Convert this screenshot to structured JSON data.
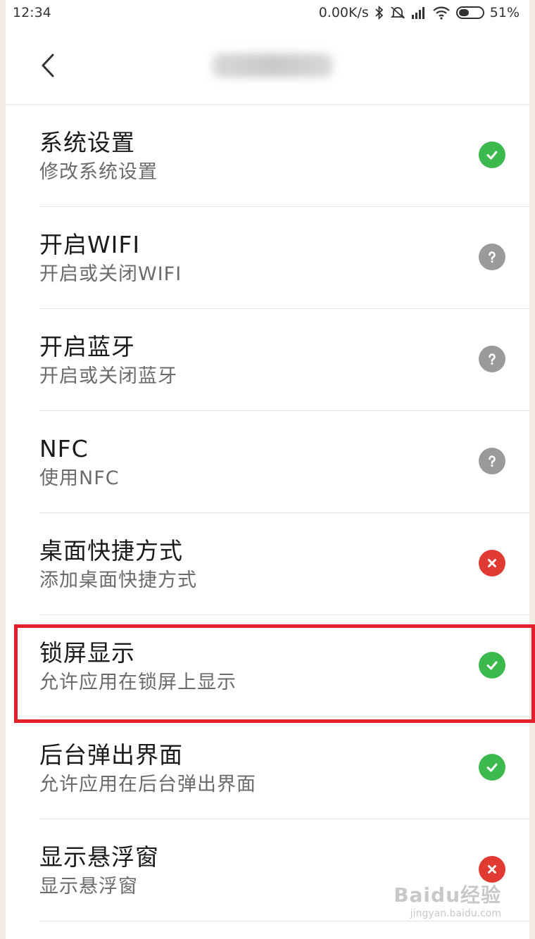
{
  "status_bar": {
    "time": "12:34",
    "net_speed": "0.00K/s",
    "battery": "51%",
    "battery_level": 0.51
  },
  "header": {
    "back_icon": "chevron-left-icon"
  },
  "colors": {
    "allowed": "#3cb94d",
    "ask": "#9a9a9a",
    "denied": "#e03a32",
    "highlight": "#e2202b"
  },
  "permissions": [
    {
      "title": "系统设置",
      "subtitle": "修改系统设置",
      "status": "allowed"
    },
    {
      "title": "开启WIFI",
      "subtitle": "开启或关闭WIFI",
      "status": "ask"
    },
    {
      "title": "开启蓝牙",
      "subtitle": "开启或关闭蓝牙",
      "status": "ask"
    },
    {
      "title": "NFC",
      "subtitle": "使用NFC",
      "status": "ask"
    },
    {
      "title": "桌面快捷方式",
      "subtitle": "添加桌面快捷方式",
      "status": "denied"
    },
    {
      "title": "锁屏显示",
      "subtitle": "允许应用在锁屏上显示",
      "status": "allowed"
    },
    {
      "title": "后台弹出界面",
      "subtitle": "允许应用在后台弹出界面",
      "status": "allowed"
    },
    {
      "title": "显示悬浮窗",
      "subtitle": "显示悬浮窗",
      "status": "denied"
    }
  ],
  "watermark": {
    "logo": "Baidu经验",
    "url": "jingyan.baidu.com"
  }
}
